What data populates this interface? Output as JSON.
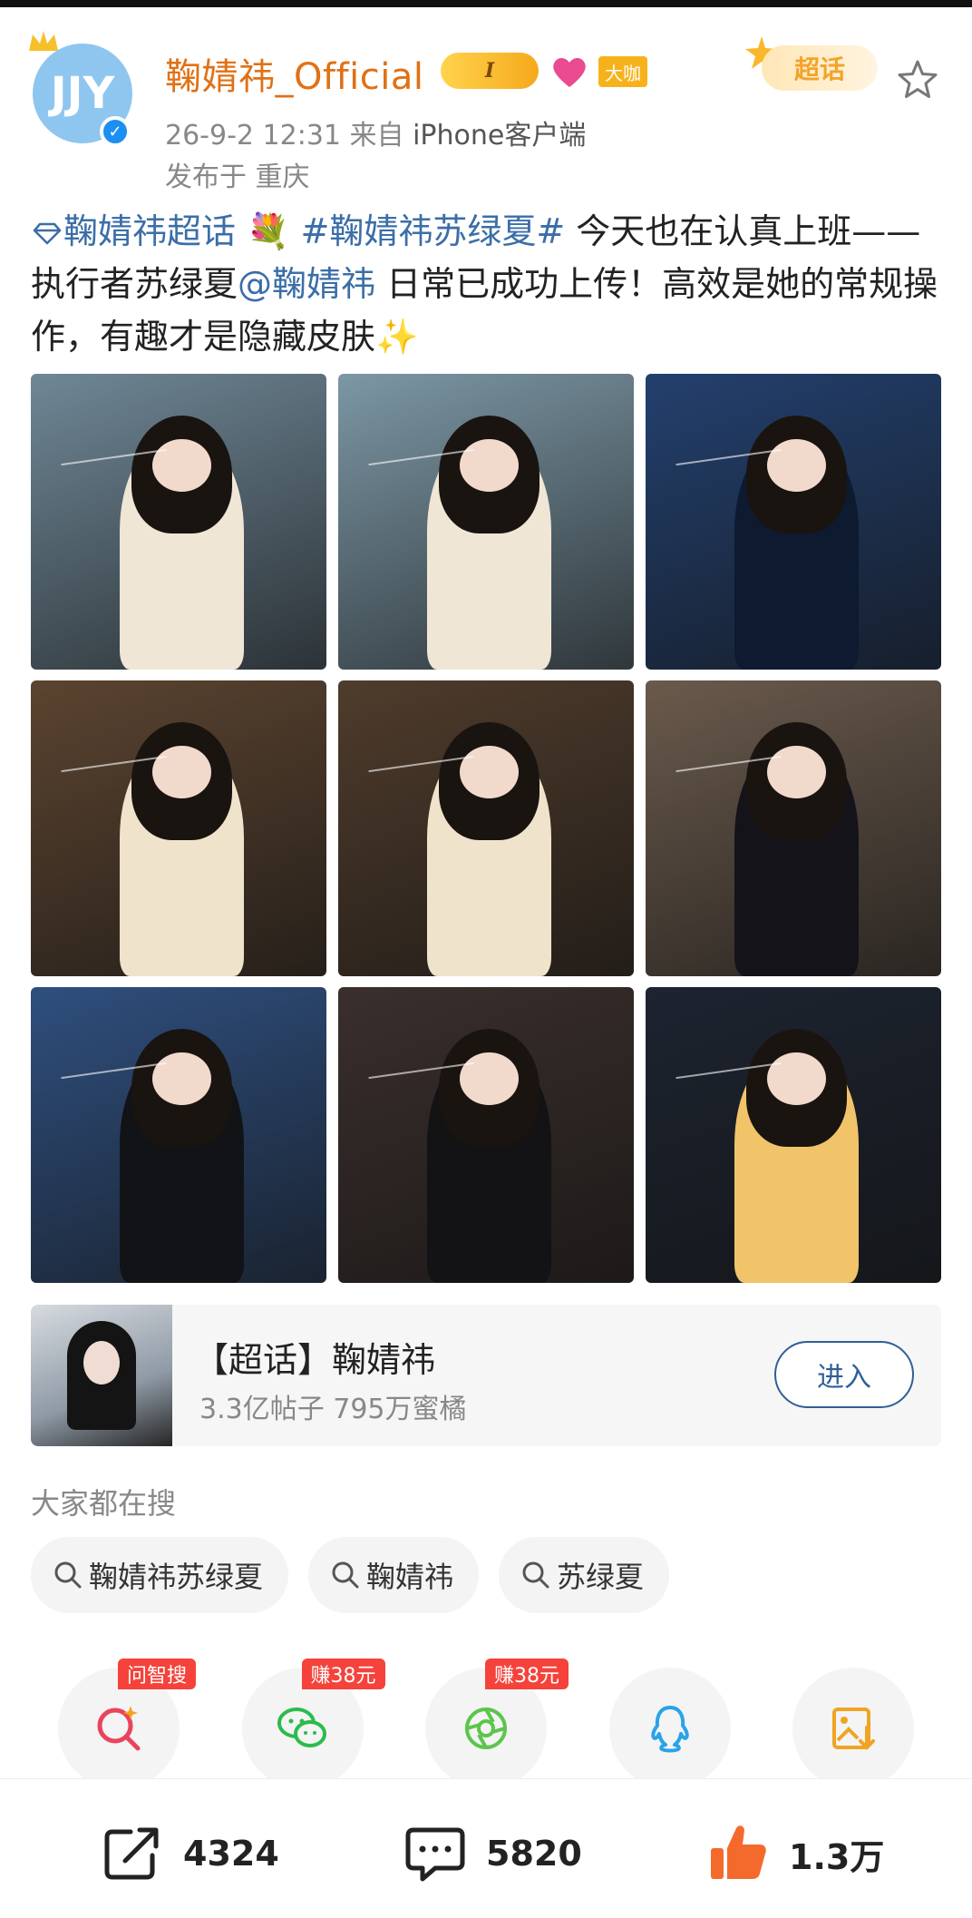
{
  "post": {
    "author": {
      "name": "鞠婧祎_Official",
      "avatar_label": "JJY",
      "vip_badge": "I",
      "role_badge": "大咖"
    },
    "timestamp": "26-9-2 12:31",
    "source_prefix": "来自",
    "source": "iPhone客户端",
    "location": "发布于 重庆",
    "supertopic_tag": "超话",
    "text": {
      "topic_link": "鞠婧祎超话",
      "hashtag": "#鞠婧祎苏绿夏#",
      "body1": " 今天也在认真上班——执行者苏绿夏",
      "mention": "@鞠婧祎",
      "body2": " 日常已成功上传！高效是她的常规操作，有趣才是隐藏皮肤",
      "sparkle": "✨"
    },
    "photos": [
      {
        "bg": "#6f8796",
        "accent": "#efe6d6"
      },
      {
        "bg": "#7c97a5",
        "accent": "#efe6d6"
      },
      {
        "bg": "#23406e",
        "accent": "#0e1a2f"
      },
      {
        "bg": "#5b4430",
        "accent": "#efe3cb"
      },
      {
        "bg": "#4f3c2c",
        "accent": "#efe3cb"
      },
      {
        "bg": "#6a5a4c",
        "accent": "#15131a"
      },
      {
        "bg": "#2f4f7e",
        "accent": "#121316"
      },
      {
        "bg": "#3a2f2c",
        "accent": "#131214"
      },
      {
        "bg": "#1d2430",
        "accent": "#f2c46a"
      }
    ]
  },
  "topic_card": {
    "title": "【超话】鞠婧祎",
    "stats": "3.3亿帖子 795万蜜橘",
    "enter_label": "进入"
  },
  "search": {
    "label": "大家都在搜",
    "chips": [
      "鞠婧祎苏绿夏",
      "鞠婧祎",
      "苏绿夏"
    ]
  },
  "share": [
    {
      "icon": "ai-search-icon",
      "badge": "问智搜",
      "color": "#e8455d"
    },
    {
      "icon": "wechat-icon",
      "badge": "赚38元",
      "color": "#2dbb4e"
    },
    {
      "icon": "moments-icon",
      "badge": "赚38元",
      "color": "#5cc54c"
    },
    {
      "icon": "qq-icon",
      "badge": "",
      "color": "#2aa3e8"
    },
    {
      "icon": "save-image-icon",
      "badge": "",
      "color": "#f0a423"
    }
  ],
  "actions": {
    "repost": "4324",
    "comment": "5820",
    "like": "1.3万"
  }
}
